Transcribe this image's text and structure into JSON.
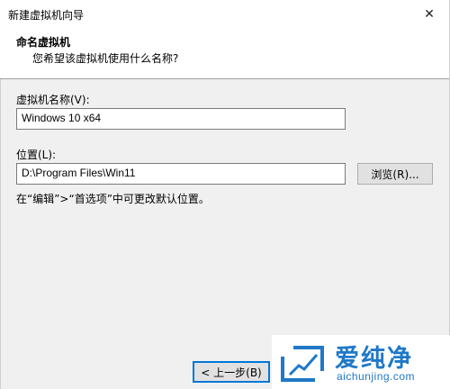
{
  "window": {
    "title": "新建虚拟机向导",
    "close_glyph": "✕"
  },
  "header": {
    "title": "命名虚拟机",
    "subtitle": "您希望该虚拟机使用什么名称?"
  },
  "form": {
    "vm_name_label": "虚拟机名称(V):",
    "vm_name_value": "Windows 10 x64",
    "location_label": "位置(L):",
    "location_value": "D:\\Program Files\\Win11",
    "browse_label": "浏览(R)...",
    "hint": "在“编辑”>“首选项”中可更改默认位置。"
  },
  "footer": {
    "back_label": "< 上一步(B)"
  },
  "watermark": {
    "name": "爱纯净",
    "url": "aichunjing.com",
    "color": "#1f78c8"
  }
}
